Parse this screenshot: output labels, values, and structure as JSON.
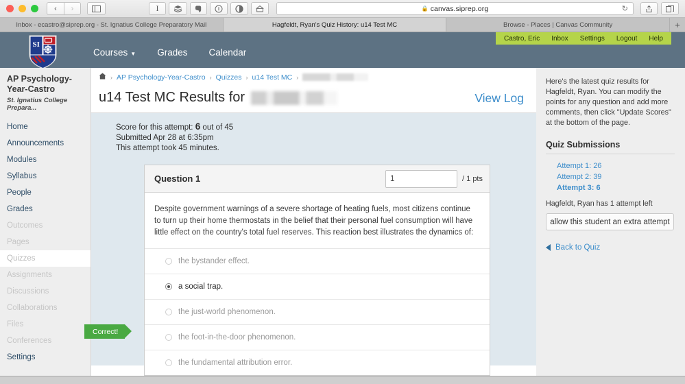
{
  "browser": {
    "window_controls": [
      "close",
      "minimize",
      "maximize"
    ],
    "nav_back": "‹",
    "nav_forward": "›",
    "sidebar_icon": "sidebar-toggle",
    "extension_icons": [
      "I",
      "≣",
      "❧",
      "①",
      "◑",
      "⌂"
    ],
    "url": "canvas.siprep.org",
    "lock": "🔒",
    "reload": "↻",
    "share_icon": "⇧",
    "tabs_icon": "❐",
    "new_tab": "+"
  },
  "tabs": [
    {
      "title": "Inbox - ecastro@siprep.org - St. Ignatius College Preparatory Mail",
      "active": false
    },
    {
      "title": "Hagfeldt, Ryan's Quiz History: u14 Test MC",
      "active": true
    },
    {
      "title": "Browse - Places | Canvas Community",
      "active": false
    }
  ],
  "canvas_header": {
    "user_menu": [
      "Castro, Eric",
      "Inbox",
      "Settings",
      "Logout",
      "Help"
    ],
    "logo_text": "SI",
    "nav": [
      {
        "label": "Courses",
        "has_caret": true
      },
      {
        "label": "Grades",
        "has_caret": false
      },
      {
        "label": "Calendar",
        "has_caret": false
      }
    ],
    "accent_green": "#b5d44a",
    "header_bg": "#5d7283"
  },
  "course_nav": {
    "course_title": "AP Psychology-Year-Castro",
    "course_subtitle": "St. Ignatius College Prepara...",
    "items": [
      {
        "label": "Home",
        "state": "normal"
      },
      {
        "label": "Announcements",
        "state": "normal"
      },
      {
        "label": "Modules",
        "state": "normal"
      },
      {
        "label": "Syllabus",
        "state": "normal"
      },
      {
        "label": "People",
        "state": "normal"
      },
      {
        "label": "Grades",
        "state": "normal"
      },
      {
        "label": "Outcomes",
        "state": "muted"
      },
      {
        "label": "Pages",
        "state": "muted"
      },
      {
        "label": "Quizzes",
        "state": "current"
      },
      {
        "label": "Assignments",
        "state": "muted"
      },
      {
        "label": "Discussions",
        "state": "muted"
      },
      {
        "label": "Collaborations",
        "state": "muted"
      },
      {
        "label": "Files",
        "state": "muted"
      },
      {
        "label": "Conferences",
        "state": "muted"
      },
      {
        "label": "Settings",
        "state": "normal"
      }
    ]
  },
  "breadcrumb": {
    "home_icon": "⌂",
    "separator": "›",
    "items": [
      "AP Psychology-Year-Castro",
      "Quizzes",
      "u14 Test MC"
    ],
    "redacted_last": ""
  },
  "page": {
    "title_prefix": "u14 Test MC Results for",
    "title_redacted": "",
    "view_log_label": "View Log"
  },
  "attempt": {
    "score_prefix": "Score for this attempt:",
    "score_value": "6",
    "score_suffix": "out of 45",
    "submitted": "Submitted Apr 28 at 6:35pm",
    "duration": "This attempt took 45 minutes."
  },
  "question": {
    "name": "Question 1",
    "points_value": "1",
    "points_label": "/ 1 pts",
    "text": "Despite government warnings of a severe shortage of heating fuels, most citizens continue to turn up their home thermostats in the belief that their personal fuel consumption will have little effect on the country's total fuel reserves. This reaction best illustrates the dynamics of:",
    "correct_flag": "Correct!",
    "answers": [
      {
        "label": "the bystander effect.",
        "selected": false
      },
      {
        "label": "a social trap.",
        "selected": true
      },
      {
        "label": "the just-world phenomenon.",
        "selected": false
      },
      {
        "label": "the foot-in-the-door phenomenon.",
        "selected": false
      },
      {
        "label": "the fundamental attribution error.",
        "selected": false
      }
    ]
  },
  "right_sidebar": {
    "intro": "Here's the latest quiz results for Hagfeldt, Ryan. You can modify the points for any question and add more comments, then click \"Update Scores\" at the bottom of the page.",
    "submissions_heading": "Quiz Submissions",
    "attempts": [
      {
        "label": "Attempt 1: 26",
        "current": false
      },
      {
        "label": "Attempt 2: 39",
        "current": false
      },
      {
        "label": "Attempt 3: 6",
        "current": true
      }
    ],
    "attempts_left_note": "Hagfeldt, Ryan has 1 attempt left",
    "extra_attempt_button": "allow this student an extra attempt",
    "back_link": "Back to Quiz"
  }
}
